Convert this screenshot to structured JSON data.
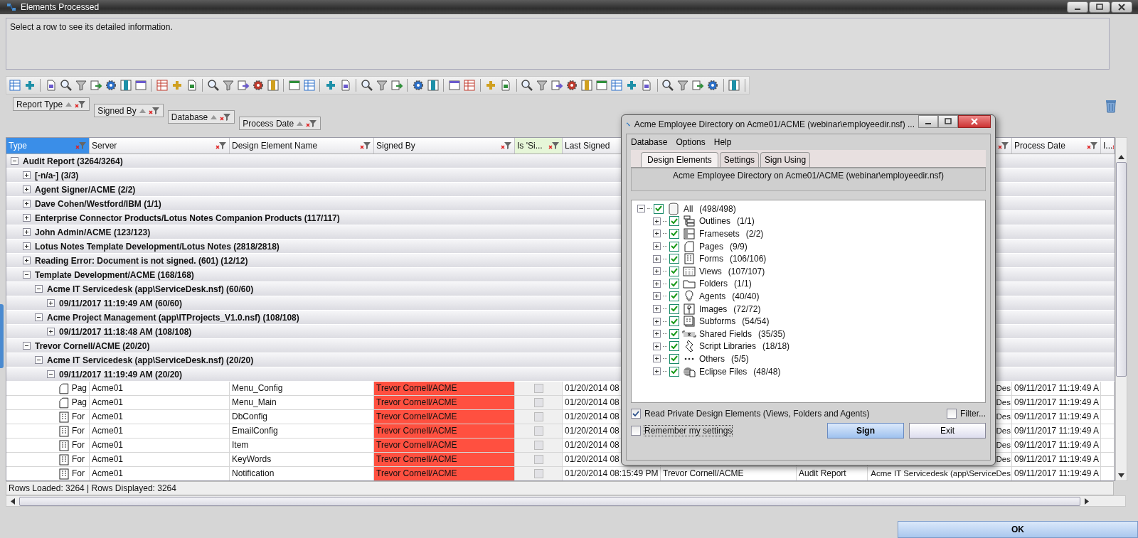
{
  "window": {
    "title": "Elements Processed"
  },
  "info_panel": {
    "text": "Select a row to see its detailed information."
  },
  "group_by": [
    {
      "label": "Report Type"
    },
    {
      "label": "Signed By"
    },
    {
      "label": "Database"
    },
    {
      "label": "Process Date"
    }
  ],
  "table": {
    "columns": [
      {
        "label": "Type",
        "selected": true,
        "highlight": false
      },
      {
        "label": "Server",
        "selected": false,
        "highlight": false
      },
      {
        "label": "Design Element Name",
        "selected": false,
        "highlight": false
      },
      {
        "label": "Signed By",
        "selected": false,
        "highlight": false
      },
      {
        "label": "Is 'Si...",
        "selected": false,
        "highlight": true
      },
      {
        "label": "Last Signed",
        "selected": false,
        "highlight": false
      },
      {
        "label": "Process Date",
        "selected": false,
        "highlight": false
      },
      {
        "label": "I...",
        "selected": false,
        "highlight": false
      }
    ],
    "groups": [
      {
        "label": "Audit Report (3264/3264)",
        "expanded": true,
        "children": [
          {
            "label": "[-n/a-] (3/3)",
            "expanded": false
          },
          {
            "label": "Agent Signer/ACME (2/2)",
            "expanded": false
          },
          {
            "label": "Dave Cohen/Westford/IBM (1/1)",
            "expanded": false
          },
          {
            "label": "Enterprise Connector Products/Lotus Notes Companion Products (117/117)",
            "expanded": false
          },
          {
            "label": "John Admin/ACME (123/123)",
            "expanded": false
          },
          {
            "label": "Lotus Notes Template Development/Lotus Notes (2818/2818)",
            "expanded": false
          },
          {
            "label": "Reading Error: Document is not signed. (601) (12/12)",
            "expanded": false
          },
          {
            "label": "Template Development/ACME (168/168)",
            "expanded": true,
            "children": [
              {
                "label": "Acme IT Servicedesk (app\\ServiceDesk.nsf) (60/60)",
                "expanded": true,
                "children": [
                  {
                    "label": "09/11/2017 11:19:49 AM (60/60)",
                    "expanded": false
                  }
                ]
              },
              {
                "label": "Acme Project Management (app\\ITProjects_V1.0.nsf) (108/108)",
                "expanded": true,
                "children": [
                  {
                    "label": "09/11/2017 11:18:48 AM (108/108)",
                    "expanded": false
                  }
                ]
              }
            ]
          },
          {
            "label": "Trevor Cornell/ACME (20/20)",
            "expanded": true,
            "children": [
              {
                "label": "Acme IT Servicedesk (app\\ServiceDesk.nsf) (20/20)",
                "expanded": true,
                "children": [
                  {
                    "label": "09/11/2017 11:19:49 AM (20/20)",
                    "expanded": true,
                    "rows": [
                      {
                        "kind": "page",
                        "type": "Pag",
                        "server": "Acme01",
                        "name": "Menu_Config",
                        "signed_by": "Trevor Cornell/ACME",
                        "flagged": true,
                        "is_signed": false,
                        "last_signed": "01/20/2014 08",
                        "database": "Des",
                        "process_date": "09/11/2017 11:19:49 A"
                      },
                      {
                        "kind": "page",
                        "type": "Pag",
                        "server": "Acme01",
                        "name": "Menu_Main",
                        "signed_by": "Trevor Cornell/ACME",
                        "flagged": true,
                        "is_signed": false,
                        "last_signed": "01/20/2014 08",
                        "database": "Des",
                        "process_date": "09/11/2017 11:19:49 A"
                      },
                      {
                        "kind": "form",
                        "type": "For",
                        "server": "Acme01",
                        "name": "DbConfig",
                        "signed_by": "Trevor Cornell/ACME",
                        "flagged": true,
                        "is_signed": false,
                        "last_signed": "01/20/2014 08",
                        "database": "Des",
                        "process_date": "09/11/2017 11:19:49 A"
                      },
                      {
                        "kind": "form",
                        "type": "For",
                        "server": "Acme01",
                        "name": "EmailConfig",
                        "signed_by": "Trevor Cornell/ACME",
                        "flagged": true,
                        "is_signed": false,
                        "last_signed": "01/20/2014 08",
                        "database": "Des",
                        "process_date": "09/11/2017 11:19:49 A"
                      },
                      {
                        "kind": "form",
                        "type": "For",
                        "server": "Acme01",
                        "name": "Item",
                        "signed_by": "Trevor Cornell/ACME",
                        "flagged": true,
                        "is_signed": false,
                        "last_signed": "01/20/2014 08",
                        "database": "Des",
                        "process_date": "09/11/2017 11:19:49 A"
                      },
                      {
                        "kind": "form",
                        "type": "For",
                        "server": "Acme01",
                        "name": "KeyWords",
                        "signed_by": "Trevor Cornell/ACME",
                        "flagged": true,
                        "is_signed": false,
                        "last_signed": "01/20/2014 08",
                        "database": "Des",
                        "process_date": "09/11/2017 11:19:49 A"
                      },
                      {
                        "kind": "form",
                        "type": "For",
                        "server": "Acme01",
                        "name": "Notification",
                        "signed_by": "Trevor Cornell/ACME",
                        "flagged": true,
                        "is_signed": false,
                        "last_signed": "01/20/2014 08:15:49 PM",
                        "signer": "Trevor Cornell/ACME",
                        "report_type": "Audit Report",
                        "database": "Acme IT Servicedesk (app\\ServiceDes",
                        "process_date": "09/11/2017 11:19:49 A"
                      }
                    ]
                  }
                ]
              }
            ]
          }
        ]
      }
    ]
  },
  "status_bar": {
    "text": "Rows Loaded: 3264  |  Rows Displayed: 3264"
  },
  "ok_button": {
    "label": "OK"
  },
  "dialog": {
    "title": "Acme Employee Directory on Acme01/ACME (webinar\\employeedir.nsf) ...",
    "menu": [
      {
        "label": "Database"
      },
      {
        "label": "Options"
      },
      {
        "label": "Help"
      }
    ],
    "tabs": [
      {
        "label": "Design Elements",
        "selected": true
      },
      {
        "label": "Settings",
        "selected": false
      },
      {
        "label": "Sign Using",
        "selected": false
      }
    ],
    "description": "Acme Employee Directory on Acme01/ACME (webinar\\employeedir.nsf)",
    "tree": {
      "kind": "database",
      "label": "All",
      "count": "(498/498)",
      "checked": true,
      "expanded": true,
      "children": [
        {
          "kind": "outline",
          "label": "Outlines",
          "count": "(1/1)",
          "checked": true,
          "expanded": false
        },
        {
          "kind": "frameset",
          "label": "Framesets",
          "count": "(2/2)",
          "checked": true,
          "expanded": false
        },
        {
          "kind": "page",
          "label": "Pages",
          "count": "(9/9)",
          "checked": true,
          "expanded": false
        },
        {
          "kind": "form",
          "label": "Forms",
          "count": "(106/106)",
          "checked": true,
          "expanded": false
        },
        {
          "kind": "view",
          "label": "Views",
          "count": "(107/107)",
          "checked": true,
          "expanded": false
        },
        {
          "kind": "folder",
          "label": "Folders",
          "count": "(1/1)",
          "checked": true,
          "expanded": false
        },
        {
          "kind": "agent",
          "label": "Agents",
          "count": "(40/40)",
          "checked": true,
          "expanded": false
        },
        {
          "kind": "image",
          "label": "Images",
          "count": "(72/72)",
          "checked": true,
          "expanded": false
        },
        {
          "kind": "subform",
          "label": "Subforms",
          "count": "(54/54)",
          "checked": true,
          "expanded": false
        },
        {
          "kind": "field",
          "label": "Shared Fields",
          "count": "(35/35)",
          "checked": true,
          "expanded": false
        },
        {
          "kind": "script",
          "label": "Script Libraries",
          "count": "(18/18)",
          "checked": true,
          "expanded": false
        },
        {
          "kind": "other",
          "label": "Others",
          "count": "(5/5)",
          "checked": true,
          "expanded": false
        },
        {
          "kind": "eclipse",
          "label": "Eclipse Files",
          "count": "(48/48)",
          "checked": true,
          "expanded": false
        }
      ]
    },
    "options": [
      {
        "label": "Read Private Design Elements (Views, Folders and Agents)",
        "checked": true
      },
      {
        "label": "Filter...",
        "checked": false
      },
      {
        "label": "Remember my settings",
        "checked": false
      }
    ],
    "buttons": [
      {
        "label": "Sign",
        "primary": true
      },
      {
        "label": "Exit",
        "primary": false
      }
    ]
  }
}
